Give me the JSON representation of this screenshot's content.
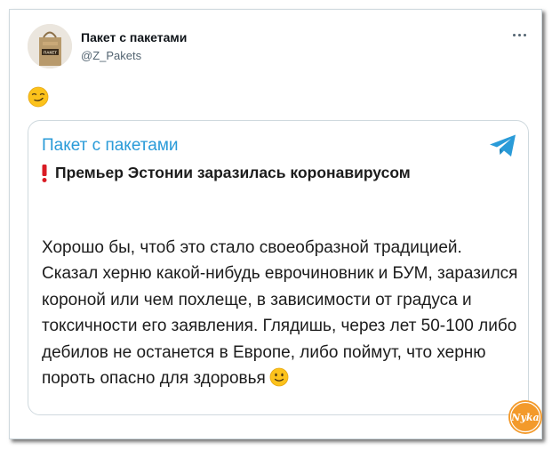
{
  "tweet": {
    "author_name": "Пакет с пакетами",
    "author_handle": "@Z_Pakets",
    "avatar_text": "ПАКЕТ",
    "more_icon": "more-dots-icon",
    "emoji": "smirk-emoji"
  },
  "card": {
    "channel_name": "Пакет с пакетами",
    "telegram_icon": "telegram-icon",
    "headline_icon": "exclamation-icon",
    "headline": "Премьер Эстонии заразилась коронавирусом",
    "body": "Хорошо бы, чтоб это стало своеобразной традицией. Сказал херню какой-нибудь еврочиновник и БУМ, заразился короной или чем похлеще, в зависимости от градуса и токсичности его заявления. Глядишь, через лет 50-100 либо дебилов не останется в Европе, либо поймут, что херню пороть опасно для здоровья",
    "body_emoji": "slight-smile-emoji"
  },
  "watermark": {
    "text": "Nyka",
    "color": "#f39a2b"
  },
  "colors": {
    "accent": "#2a9bd8",
    "border": "#cfd9de",
    "handle": "#536471"
  }
}
